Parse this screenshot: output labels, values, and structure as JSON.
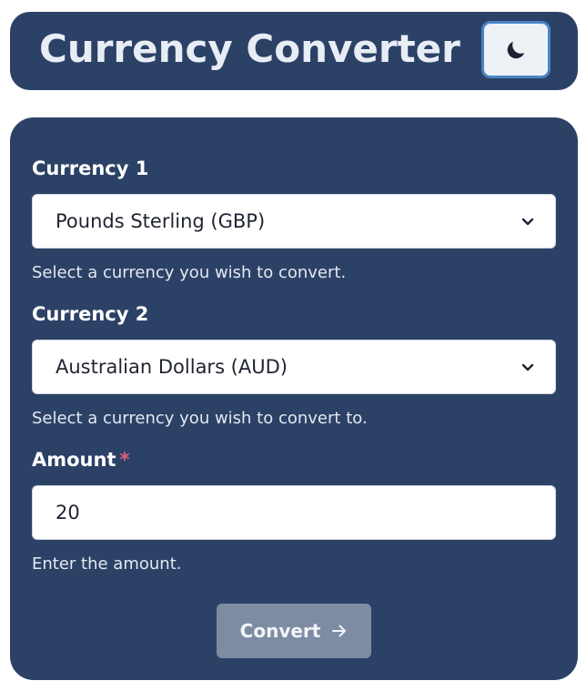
{
  "header": {
    "title": "Currency Converter",
    "theme_toggle_icon": "moon-icon"
  },
  "form": {
    "currency1": {
      "label": "Currency 1",
      "selected": "Pounds Sterling (GBP)",
      "hint": "Select a currency you wish to convert."
    },
    "currency2": {
      "label": "Currency 2",
      "selected": "Australian Dollars (AUD)",
      "hint": "Select a currency you wish to convert to."
    },
    "amount": {
      "label": "Amount",
      "required_marker": "*",
      "value": "20",
      "hint": "Enter the amount."
    },
    "convert_label": "Convert",
    "convert_icon": "arrow-right-icon"
  },
  "colors": {
    "panel_bg": "#2c4166",
    "button_bg": "#7e8ca3",
    "required": "#e0607a",
    "toggle_border": "#4a84c4"
  }
}
